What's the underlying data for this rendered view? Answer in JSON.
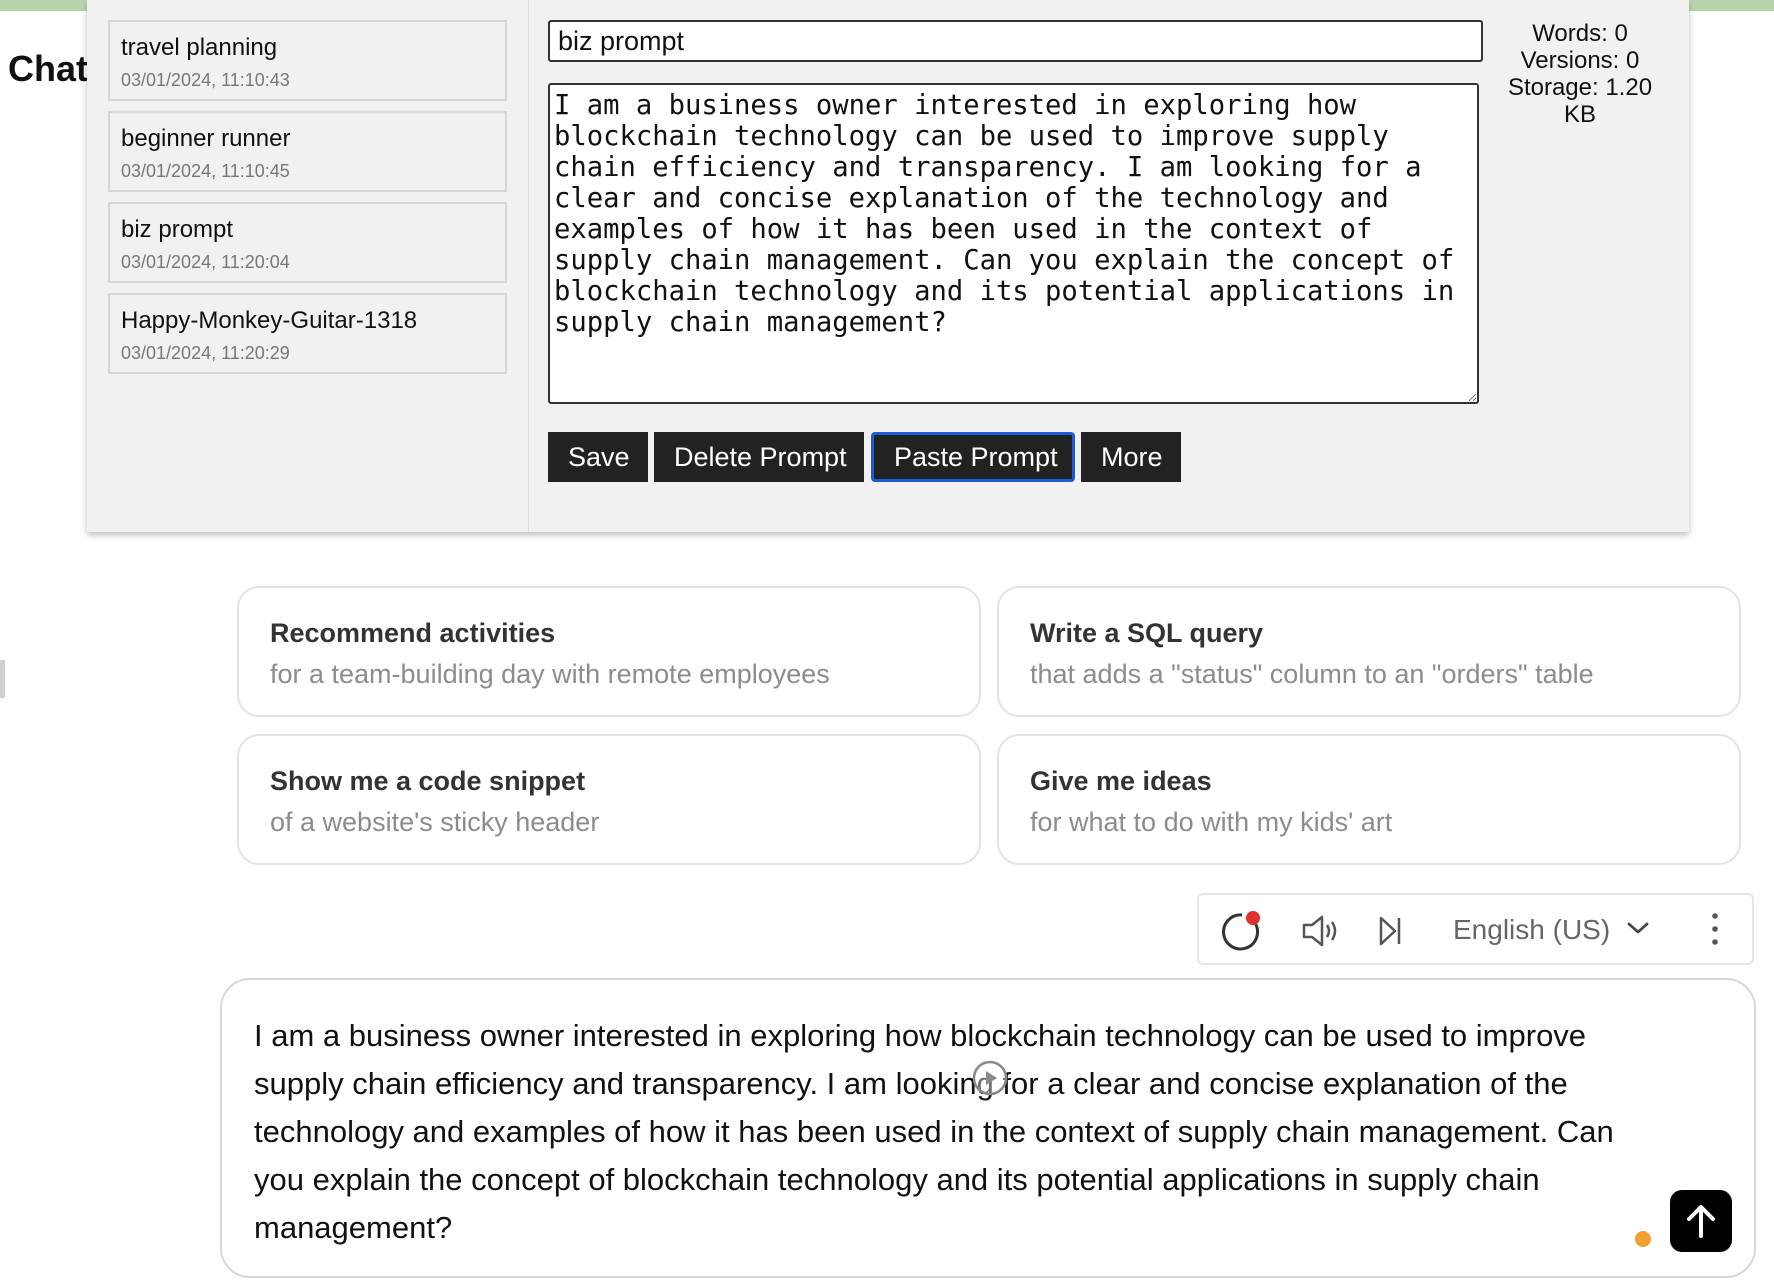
{
  "app": {
    "title": "Chat"
  },
  "prompt_manager": {
    "items": [
      {
        "name": "travel planning",
        "date": "03/01/2024, 11:10:43"
      },
      {
        "name": "beginner runner",
        "date": "03/01/2024, 11:10:45"
      },
      {
        "name": "biz prompt",
        "date": "03/01/2024, 11:20:04"
      },
      {
        "name": "Happy-Monkey-Guitar-1318",
        "date": "03/01/2024, 11:20:29"
      }
    ],
    "title_value": "biz prompt",
    "prompt_text": "I am a business owner interested in exploring how blockchain technology can be used to improve supply chain efficiency and transparency. I am looking for a clear and concise explanation of the technology and examples of how it has been used in the context of supply chain management. Can you explain the concept of blockchain technology and its potential applications in supply chain management?",
    "buttons": {
      "save": "Save",
      "delete": "Delete Prompt",
      "paste": "Paste Prompt",
      "more": "More"
    },
    "stats": {
      "words": "Words: 0",
      "versions": "Versions: 0",
      "storage": "Storage: 1.20 KB"
    }
  },
  "suggestions": [
    {
      "title": "Recommend activities",
      "subtitle": "for a team-building day with remote employees"
    },
    {
      "title": "Write a SQL query",
      "subtitle": "that adds a \"status\" column to an \"orders\" table"
    },
    {
      "title": "Show me a code snippet",
      "subtitle": "of a website's sticky header"
    },
    {
      "title": "Give me ideas",
      "subtitle": "for what to do with my kids' art"
    }
  ],
  "voice_toolbar": {
    "language": "English (US)",
    "icons": [
      "record-icon",
      "speaker-icon",
      "skip-icon",
      "chevron-down-icon",
      "more-vertical-icon"
    ],
    "record_dot_color": "#e03030"
  },
  "chat_input": {
    "value": "I am a business owner interested in exploring how blockchain technology can be used to improve supply chain efficiency and transparency. I am looking for a clear and concise explanation of the technology and examples of how it has been used in the context of supply chain management. Can you explain the concept of blockchain technology and its potential applications in supply chain management?",
    "indicator_color": "#f0a030"
  }
}
